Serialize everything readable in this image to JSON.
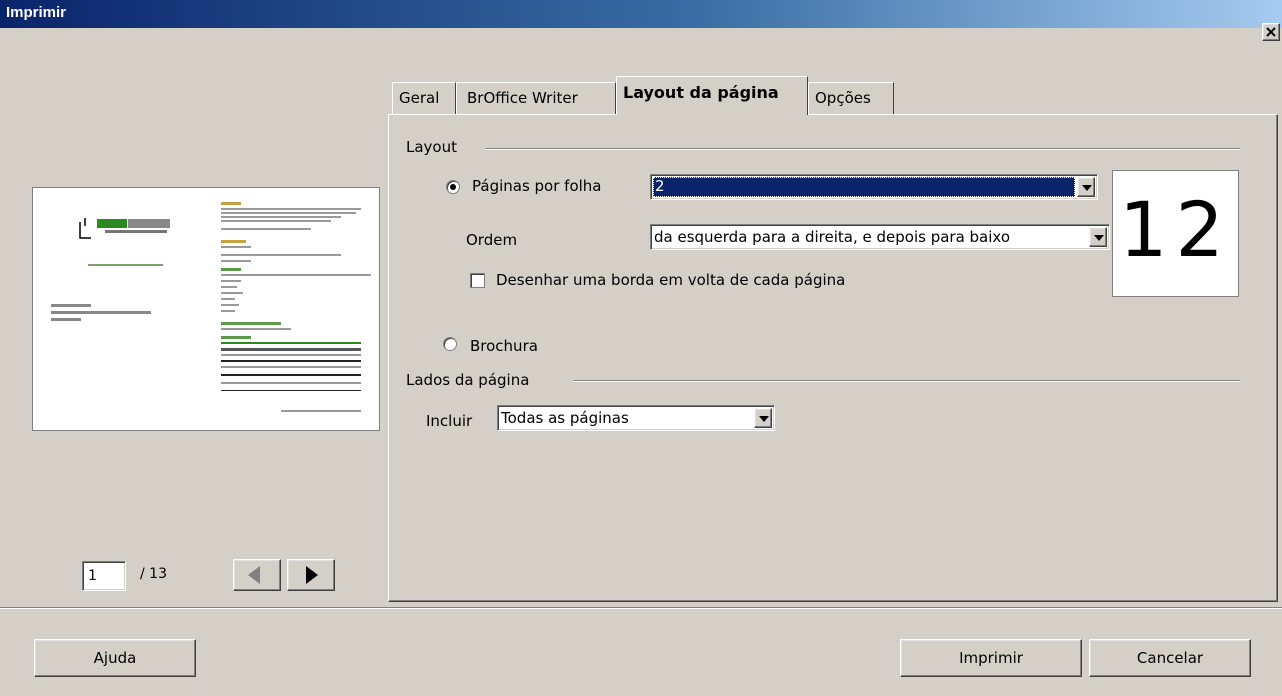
{
  "window": {
    "title": "Imprimir",
    "close_label": "✕"
  },
  "preview": {
    "current_page": "1",
    "total_pages": "/ 13"
  },
  "tabs": [
    {
      "label": "Geral"
    },
    {
      "label": "BrOffice Writer"
    },
    {
      "label": "Layout da página"
    },
    {
      "label": "Opções"
    }
  ],
  "layout": {
    "group_label": "Layout",
    "pages_per_sheet": {
      "label": "Páginas por folha",
      "value": "2",
      "selected": true
    },
    "order": {
      "label": "Ordem",
      "value": "da esquerda para a direita, e depois para baixo"
    },
    "draw_border": {
      "label": "Desenhar uma borda em volta de cada página",
      "checked": false
    },
    "brochure": {
      "label": "Brochura",
      "selected": false
    },
    "sample_text": "12"
  },
  "page_sides": {
    "group_label": "Lados da página",
    "include_label": "Incluir",
    "include_value": "Todas as páginas"
  },
  "buttons": {
    "help": "Ajuda",
    "print": "Imprimir",
    "cancel": "Cancelar"
  }
}
